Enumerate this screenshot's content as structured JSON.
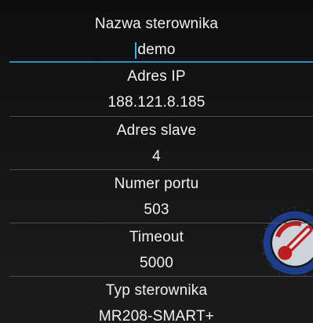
{
  "form": {
    "fields": [
      {
        "label": "Nazwa sterownika",
        "value": "demo"
      },
      {
        "label": "Adres IP",
        "value": "188.121.8.185"
      },
      {
        "label": "Adres slave",
        "value": "4"
      },
      {
        "label": "Numer portu",
        "value": "503"
      },
      {
        "label": "Timeout",
        "value": "5000"
      },
      {
        "label": "Typ sterownika",
        "value": "MR208-SMART+"
      }
    ],
    "focused_field": "Nazwa sterownika"
  },
  "colors": {
    "background": "#111213",
    "text": "#f2f2f2",
    "divider": "#4a4c4e",
    "focus_accent": "#2a8fbd",
    "logo_red": "#c81e1e",
    "logo_blue": "#1f3f8f"
  },
  "icons": {
    "watermark": "thermometer-gauge-logo"
  }
}
